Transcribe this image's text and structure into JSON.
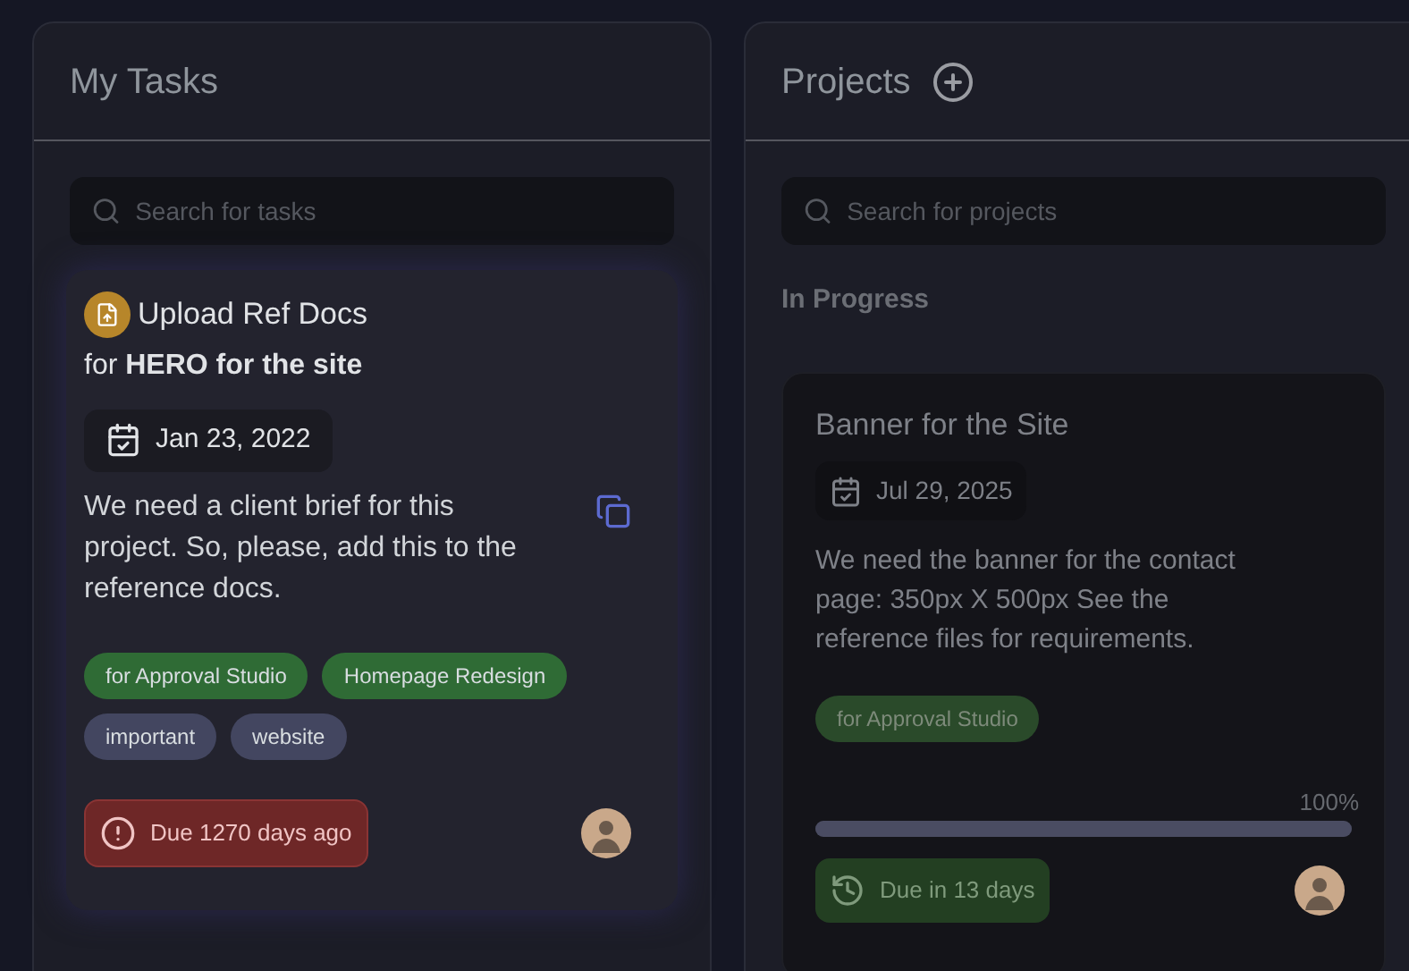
{
  "tasks_panel": {
    "title": "My Tasks",
    "search": {
      "placeholder": "Search for tasks"
    },
    "task": {
      "title": "Upload Ref Docs",
      "project": "for **HERO for the site**",
      "date": "Jan 23, 2022",
      "description": "We need a client brief for this project. So, please, add this to the reference docs.",
      "tags": [
        {
          "label": "for Approval Studio",
          "color": "#2f6b35"
        },
        {
          "label": "Homepage Redesign",
          "color": "#2f6b35"
        },
        {
          "label": "important",
          "color": "#434660"
        },
        {
          "label": "website",
          "color": "#434660"
        }
      ],
      "due": {
        "label": "Due 1270 days ago",
        "kind": "overdue"
      }
    }
  },
  "projects_panel": {
    "title": "Projects",
    "search": {
      "placeholder": "Search for projects"
    },
    "section": "In Progress",
    "project": {
      "title": "Banner for the Site",
      "date": "Jul 29, 2025",
      "description": "We need the banner for the contact page: 350px X 500px See the reference files for requirements.",
      "tags": [
        {
          "label": "for Approval Studio",
          "color": "#2a4a2a"
        }
      ],
      "progress": {
        "level": 1.0,
        "reading": "100%"
      },
      "due": {
        "label": "Due in 13 days",
        "kind": "upcoming"
      }
    }
  }
}
